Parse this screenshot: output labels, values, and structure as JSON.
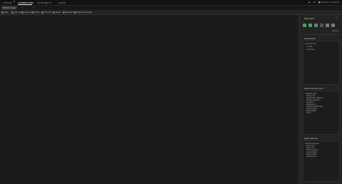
{
  "topbar": {
    "brand": "TERRAIN",
    "nav": [
      "CONNECTIONS",
      "MY PROJECTS",
      "LEARN"
    ],
    "active_index": 0,
    "icons": [
      "bell-icon",
      "gear-icon",
      "user-icon"
    ],
    "user": "connected to localhost"
  },
  "tabs": {
    "items": [
      {
        "label": "Untitled Graph"
      }
    ]
  },
  "toolbar": {
    "items": [
      "New",
      "Add node",
      "Layout",
      "Zoom",
      "Fit view",
      "Reset",
      "Refresh all",
      "Export as Graph"
    ]
  },
  "sidebar": {
    "title": "Net Insert",
    "options_label": "Options",
    "icons": [
      "green",
      "green",
      "grey",
      "dark",
      "grey",
      "grey"
    ],
    "panels": [
      {
        "title": "Key Preview",
        "items": [
          "no-name-node",
          "no-data",
          "properties"
        ]
      },
      {
        "title": "Node Inventory-card",
        "items": [
          "Available types",
          "Class-node",
          "Relationship attribute",
          "Primary key-field",
          "Summary",
          "Database id",
          "Attribute-relationship",
          "Cluster-graph",
          "Edge-weight",
          "Index"
        ]
      },
      {
        "title": "Style Inspector",
        "items": [
          "Selected style set",
          "Node color",
          "Edge color",
          "Font-size-node",
          "Label-position",
          "Border-width",
          "Opacity-level"
        ]
      }
    ]
  }
}
